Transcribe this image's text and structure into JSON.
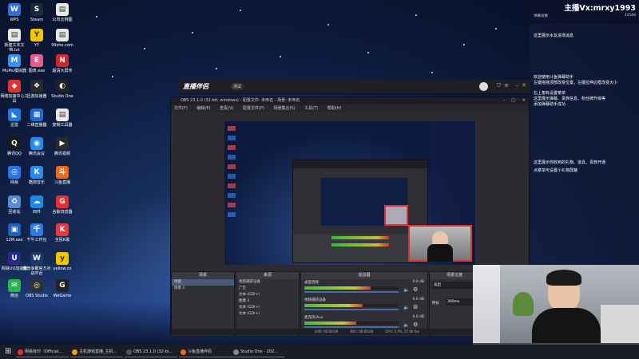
{
  "desktop_icons": [
    {
      "label": "WPS",
      "color": "#2f6fd8",
      "glyph": "W"
    },
    {
      "label": "Steam",
      "color": "#1b2838",
      "glyph": "S"
    },
    {
      "label": "公司比例图",
      "color": "#e8e8e8",
      "glyph": "▤"
    },
    {
      "label": "新建文本文档.txt",
      "color": "#e8e8e8",
      "glyph": "▤"
    },
    {
      "label": "YY",
      "color": "#f4c400",
      "glyph": "Y"
    },
    {
      "label": "99zhe.com",
      "color": "#e8e8e8",
      "glyph": "▤"
    },
    {
      "label": "MuMu模拟器",
      "color": "#3a8ef0",
      "glyph": "M"
    },
    {
      "label": "图表.exe",
      "color": "#e85a8a",
      "glyph": "E"
    },
    {
      "label": "超清大屏传",
      "color": "#d02828",
      "glyph": "N"
    },
    {
      "label": "网络加速中心工具",
      "color": "#e83030",
      "glyph": "◆"
    },
    {
      "label": "迅游加速器",
      "color": "#2a2a2a",
      "glyph": "❖"
    },
    {
      "label": "Studio One",
      "color": "#222",
      "glyph": "◐"
    },
    {
      "label": "迅雷",
      "color": "#1a7ae8",
      "glyph": "◣"
    },
    {
      "label": "二维直播器",
      "color": "#1a6ad8",
      "glyph": "▦"
    },
    {
      "label": "复制工具器",
      "color": "#e8e8e8",
      "glyph": "▤"
    },
    {
      "label": "腾讯QQ",
      "color": "#1a1a1a",
      "glyph": "Q"
    },
    {
      "label": "腾讯会议",
      "color": "#2a8ae8",
      "glyph": "◉"
    },
    {
      "label": "腾讯视频",
      "color": "#2a2a2a",
      "glyph": "▶"
    },
    {
      "label": "网易",
      "color": "#2b75e8",
      "glyph": "◎"
    },
    {
      "label": "酷狗音乐",
      "color": "#2a8af0",
      "glyph": "K"
    },
    {
      "label": "斗鱼直播",
      "color": "#f06a1a",
      "glyph": "斗"
    },
    {
      "label": "回收站",
      "color": "#5a8ad0",
      "glyph": "♻"
    },
    {
      "label": "四件",
      "color": "#1a8ae8",
      "glyph": "☁"
    },
    {
      "label": "谷歌浏览器",
      "color": "#e83030",
      "glyph": "G"
    },
    {
      "label": "12M.exe",
      "color": "#2060c0",
      "glyph": "▣"
    },
    {
      "label": "千牛工作台",
      "color": "#2a7ae8",
      "glyph": "千"
    },
    {
      "label": "全民K歌",
      "color": "#e83a3a",
      "glyph": "K"
    },
    {
      "label": "网易UU加速器",
      "color": "#2a2a8a",
      "glyph": "U"
    },
    {
      "label": "魔兽争霸官方对战平台",
      "color": "#1a3a6a",
      "glyph": "W"
    },
    {
      "label": "yellow.co",
      "color": "#f4c400",
      "glyph": "y"
    },
    {
      "label": "微信",
      "color": "#2ab44a",
      "glyph": "✉"
    },
    {
      "label": "OBS Studio",
      "color": "#303030",
      "glyph": "◎"
    },
    {
      "label": "WeGame",
      "color": "#222",
      "glyph": "G"
    }
  ],
  "right_panel": {
    "title": "主播Vx:mrxy1993",
    "stats_left": "弹幕总数",
    "stats_right": "33588",
    "lines": [
      "这里展示水友进场消息",
      "欢迎使用斗鱼弹幕助手",
      "左键拖拽顶部改变位置，左键拉伸边框改变大小",
      "右上角有设置菜单",
      "这里展示弹幕、贵族信息、粉丝牌升级等",
      "添加弹幕助手成功",
      "这里展示你收到的礼物、道具、贵族开通",
      "点菜单可设置小礼物屏蔽"
    ]
  },
  "obs_outer": {
    "brand": "直播伴侣",
    "version": "测试"
  },
  "obs": {
    "title": "OBS 23.1.0 (32-bit, windows) - 配置文件: 未命名 - 场景: 未命名",
    "menu": [
      "文件(F)",
      "编辑(E)",
      "查看(V)",
      "配置文件(P)",
      "场景集合(S)",
      "工具(T)",
      "帮助(H)"
    ],
    "docks": {
      "scenes": {
        "title": "场景",
        "items": [
          "场景",
          "场景 2"
        ]
      },
      "sources": {
        "title": "来源",
        "items": [
          "视频捕获设备",
          "广告",
          "文本 (GDI+)",
          "图像 3",
          "文本 (GDI+)",
          "文本 (GDI+)"
        ]
      },
      "mixer": {
        "title": "混音器",
        "tracks": [
          {
            "name": "桌面音频",
            "db": "0.0 dB",
            "level": 0.7
          },
          {
            "name": "视频捕获设备",
            "db": "0.0 dB",
            "level": 0.62
          },
          {
            "name": "麦克风/Aux",
            "db": "0.0 dB",
            "level": 0.55
          }
        ]
      },
      "transitions": {
        "title": "场景过渡",
        "mode": "淡出",
        "duration_label": "时长",
        "duration": "300ms"
      }
    },
    "status": {
      "live": "LIVE: 00:00:00",
      "rec": "REC: 00:00:00",
      "cpu": "CPU: 3.7%, 57.00 fps"
    }
  },
  "taskbar": {
    "items": [
      {
        "label": "网易有印（Official...",
        "color": "#e83030"
      },
      {
        "label": "主机游戏直播_主机...",
        "color": "#e8a020"
      },
      {
        "label": "OBS 23.1.0 (32-bi...",
        "color": "#555"
      },
      {
        "label": "斗鱼直播伴侣",
        "color": "#f06a1a"
      },
      {
        "label": "Studio One - 202...",
        "color": "#888"
      }
    ]
  }
}
